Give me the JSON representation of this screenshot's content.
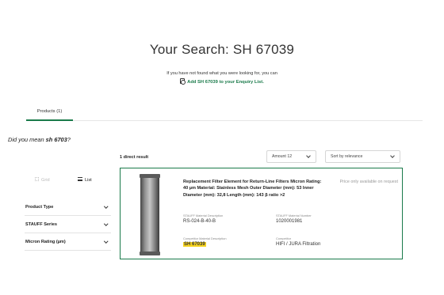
{
  "search": {
    "title": "Your Search: SH 67039",
    "not_found_text": "If you have not found what you were looking for, you can",
    "enquiry_link": "Add SH 67039 to your Enquiry List.",
    "enquiry_icon": "document-add-icon"
  },
  "tabs": [
    {
      "label": "Products (1)",
      "active": true
    }
  ],
  "did_you_mean": {
    "prefix": "Did you mean ",
    "term": "sh 6703",
    "suffix": "?"
  },
  "results": {
    "count_label": "1 direct result",
    "amount_select": "Amount 12",
    "sort_select": "Sort by relevance"
  },
  "view": {
    "grid_label": "Grid",
    "list_label": "List",
    "active": "List"
  },
  "filters": [
    {
      "label": "Product Type"
    },
    {
      "label": "STAUFF Series"
    },
    {
      "label": "Micron Rating (µm)"
    }
  ],
  "product": {
    "title": "Replacement Filter Element for Return-Line Filters Micron Rating: 40 µm Material: Stainless Mesh Outer Diameter (mm): 53 Inner Diameter (mm): 32,8 Length (mm): 143 β ratio >2",
    "price_note": "Price only available on request",
    "material_description_label": "STAUFF Material Description",
    "material_description": "RS-024-B-40-B",
    "material_number_label": "STAUFF Material Number",
    "material_number": "1020001981",
    "competitor_description_label": "Competitor Material Description",
    "competitor_description": "SH 67039",
    "competitor_label": "Competitor",
    "competitor": "HIFI / JURA Filtration"
  },
  "colors": {
    "accent_green": "#1a7a4a",
    "highlight_yellow": "#f6d31f"
  }
}
